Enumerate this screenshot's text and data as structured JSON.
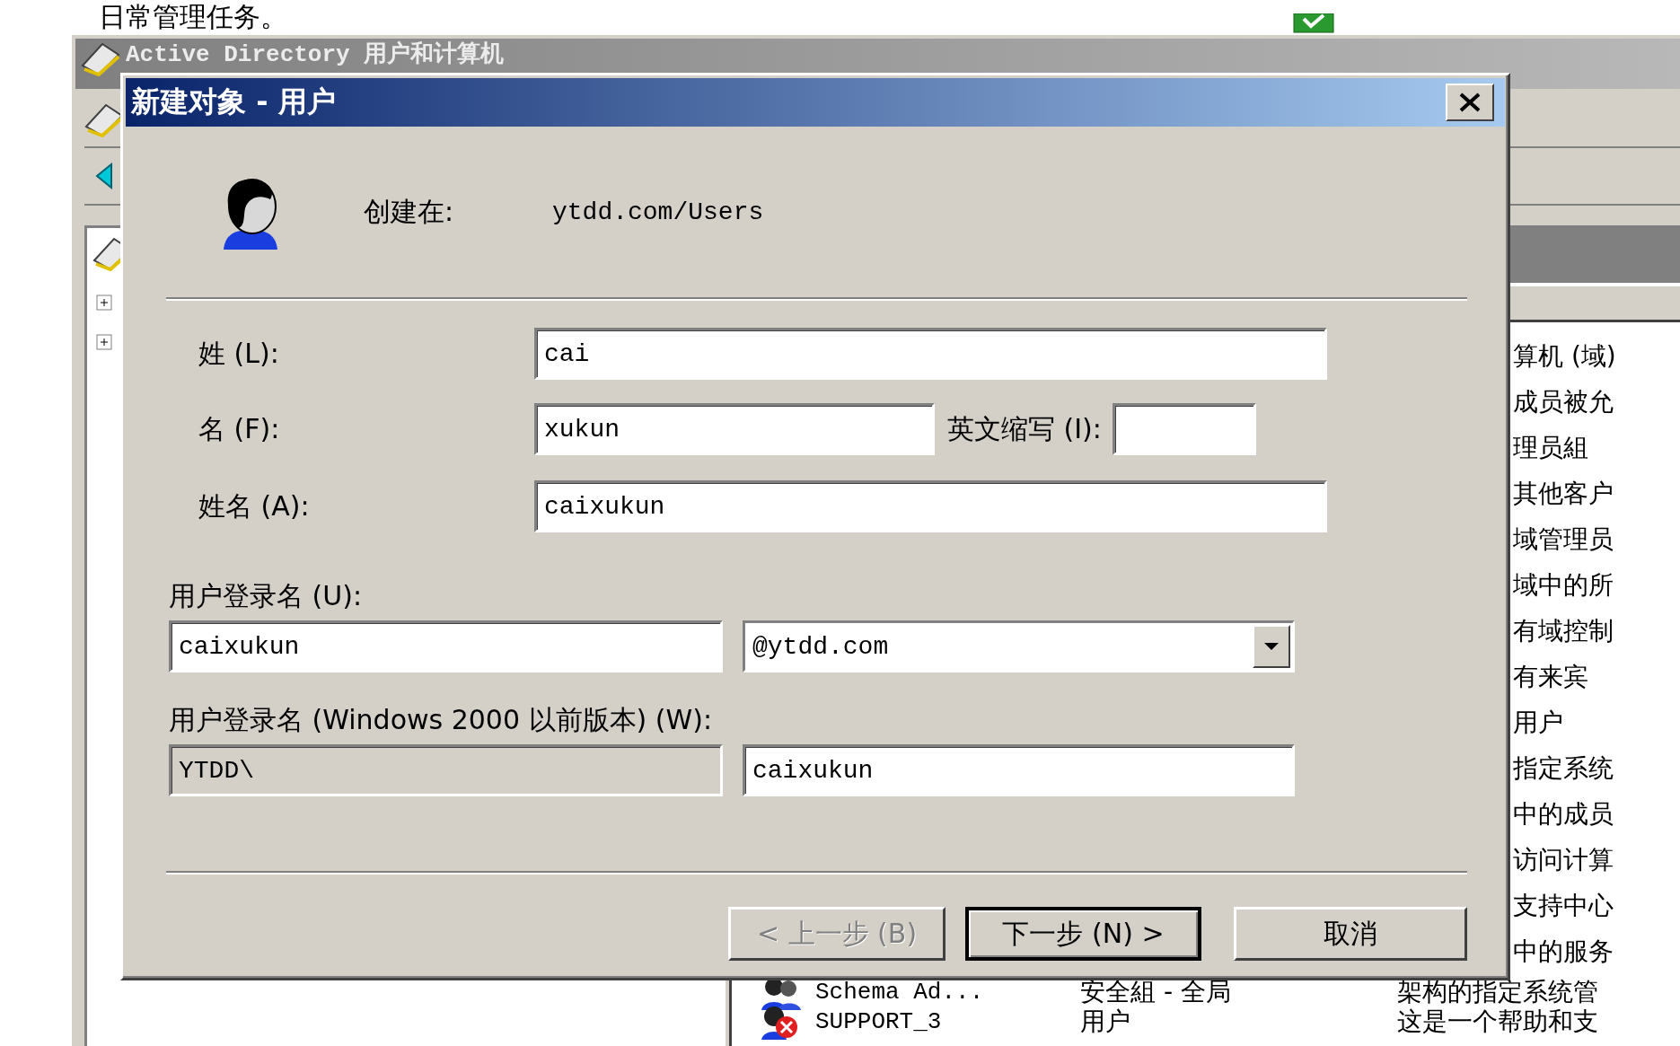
{
  "page_heading": "日常管理任务。",
  "mmc": {
    "title": "Active Directory 用户和计算机",
    "list_rows": [
      {
        "kind": "partial",
        "description": "算机 (域)"
      },
      {
        "kind": "partial",
        "description": "成员被允"
      },
      {
        "kind": "partial",
        "description": "理员組"
      },
      {
        "kind": "partial",
        "description": "其他客户"
      },
      {
        "kind": "partial",
        "description": "域管理员"
      },
      {
        "kind": "partial",
        "description": "域中的所"
      },
      {
        "kind": "partial",
        "description": "有域控制"
      },
      {
        "kind": "partial",
        "description": "有来宾"
      },
      {
        "kind": "partial",
        "description": "用户"
      },
      {
        "kind": "partial",
        "description": "指定系统"
      },
      {
        "kind": "partial",
        "description": "中的成员"
      },
      {
        "kind": "partial",
        "description": "访问计算"
      },
      {
        "kind": "partial",
        "description": "支持中心"
      },
      {
        "kind": "partial",
        "description": "中的服务"
      },
      {
        "kind": "group",
        "name": "Schema Ad...",
        "type": "安全組 - 全局",
        "description": "架构的指定系统管"
      },
      {
        "kind": "disabled-user",
        "name": "SUPPORT_3",
        "type": "用户",
        "description": "这是一个帮助和支"
      }
    ]
  },
  "dialog": {
    "title": "新建对象 - 用户",
    "created_in_label": "创建在:",
    "created_in_value": "ytdd.com/Users",
    "surname": {
      "label": "姓 (L):",
      "value": "cai"
    },
    "given_name": {
      "label": "名 (F):",
      "value": "xukun"
    },
    "initials": {
      "label": "英文缩写 (I):"
    },
    "full_name": {
      "label": "姓名 (A):",
      "value": "caixukun"
    },
    "logon_name": {
      "label": "用户登录名 (U):",
      "value": "caixukun",
      "domain": "@ytdd.com"
    },
    "pre2000": {
      "label": "用户登录名 (Windows 2000 以前版本) (W):",
      "prefix": {
        "value": "YTDD\\",
        "disabled": true
      },
      "value": "caixukun"
    },
    "buttons": [
      {
        "label": "< 上一步 (B)",
        "disabled": true,
        "default": false
      },
      {
        "label": "下一步 (N) >",
        "disabled": false,
        "default": true
      },
      {
        "label": "取消",
        "disabled": false,
        "default": false
      }
    ]
  }
}
